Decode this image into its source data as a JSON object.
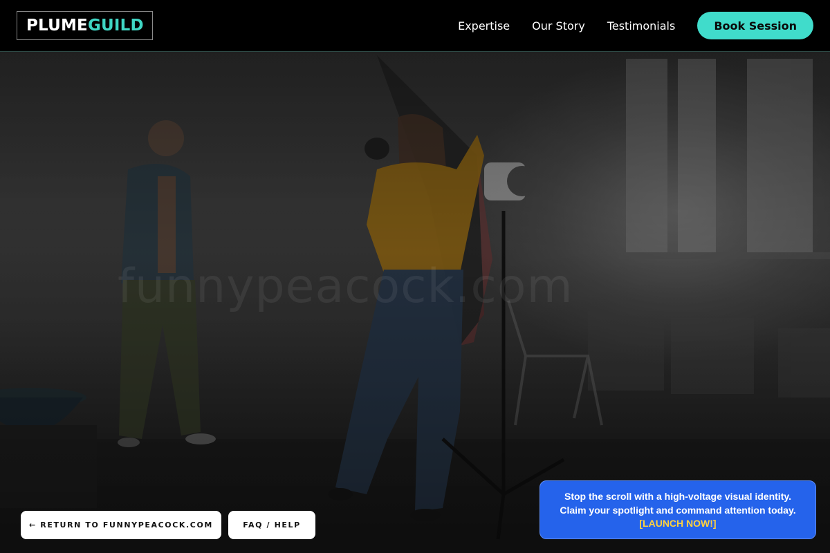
{
  "header": {
    "logo": {
      "part_a": "PLUME",
      "part_b": "GUILD"
    },
    "nav": [
      {
        "label": "Expertise"
      },
      {
        "label": "Our Story"
      },
      {
        "label": "Testimonials"
      }
    ],
    "cta_label": "Book Session"
  },
  "hero": {
    "watermark": "funnypeacock.com",
    "image": "photo-studio-shoot-background"
  },
  "footer_buttons": {
    "return_label": "← RETURN TO FUNNYPEACOCK.COM",
    "faq_label": "FAQ / HELP"
  },
  "promo": {
    "line1": "Stop the scroll with a high-voltage visual identity.",
    "line2": "Claim your spotlight and command attention today.",
    "cta": "[LAUNCH NOW!]"
  },
  "colors": {
    "accent": "#40dccb",
    "logo_accent": "#3fd6c4",
    "promo_bg": "#2563eb",
    "promo_cta": "#ffd23f",
    "header_bg": "#000000"
  }
}
